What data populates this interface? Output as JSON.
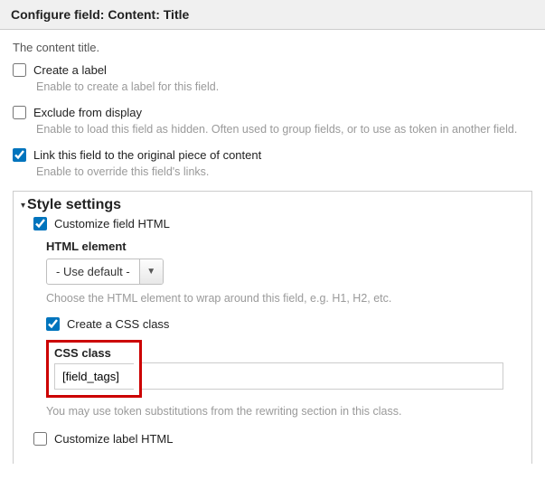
{
  "header": {
    "title": "Configure field: Content: Title"
  },
  "intro": "The content title.",
  "options": {
    "create_label": {
      "label": "Create a label",
      "checked": false,
      "help": "Enable to create a label for this field."
    },
    "exclude": {
      "label": "Exclude from display",
      "checked": false,
      "help": "Enable to load this field as hidden. Often used to group fields, or to use as token in another field."
    },
    "link_original": {
      "label": "Link this field to the original piece of content",
      "checked": true,
      "help": "Enable to override this field's links."
    }
  },
  "style": {
    "section_title": "Style settings",
    "customize_field_html": {
      "label": "Customize field HTML",
      "checked": true
    },
    "html_element": {
      "label": "HTML element",
      "selected": "- Use default -",
      "help": "Choose the HTML element to wrap around this field, e.g. H1, H2, etc."
    },
    "create_css_class": {
      "label": "Create a CSS class",
      "checked": true
    },
    "css_class": {
      "label": "CSS class",
      "value": "[field_tags]",
      "help": "You may use token substitutions from the rewriting section in this class."
    },
    "customize_label_html": {
      "label": "Customize label HTML",
      "checked": false
    }
  }
}
